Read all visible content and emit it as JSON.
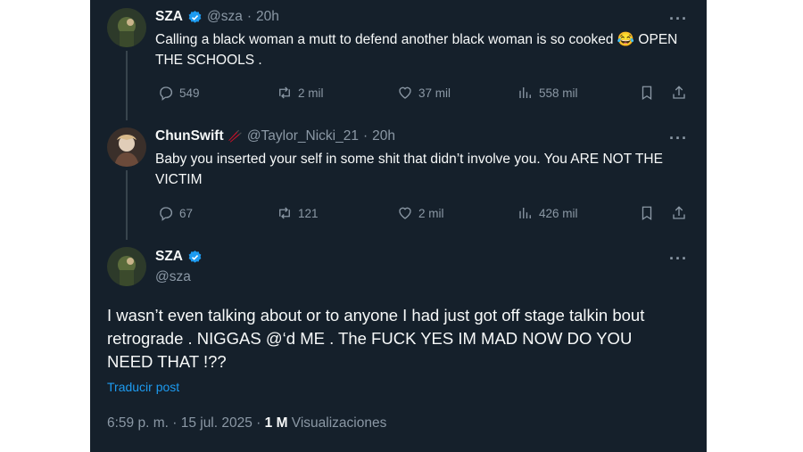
{
  "tweets": [
    {
      "name": "SZA",
      "handle": "@sza",
      "separator": "·",
      "time": "20h",
      "text": "Calling a black woman a mutt to defend another black woman is so cooked 😂 OPEN THE SCHOOLS .",
      "stats": {
        "replies": "549",
        "reposts": "2 mil",
        "likes": "37 mil",
        "views": "558 mil"
      }
    },
    {
      "name": "ChunSwift",
      "name_emoji": "🥢",
      "handle": "@Taylor_Nicki_21",
      "separator": "·",
      "time": "20h",
      "text": "Baby you inserted your self in some shit that didn’t involve you. You ARE NOT THE VICTIM",
      "stats": {
        "replies": "67",
        "reposts": "121",
        "likes": "2 mil",
        "views": "426 mil"
      }
    }
  ],
  "main": {
    "name": "SZA",
    "handle": "@sza",
    "text": "I wasn’t even talking about or to anyone I had just got off stage talkin bout retrograde .  NIGGAS @‘d ME . The FUCK YES IM MAD NOW DO YOU NEED THAT !??",
    "translate": "Traducir post",
    "time": "6:59 p. m. · 15 jul. 2025 ·",
    "views_count": "1 M",
    "views_label": "Visualizaciones"
  },
  "more_glyph": "···",
  "colors": {
    "background": "#15202b",
    "text": "#f7f9f9",
    "muted": "#8b98a5",
    "accent": "#1d9bf0"
  },
  "icons": [
    "verified-badge-icon",
    "reply-icon",
    "repost-icon",
    "like-icon",
    "views-icon",
    "bookmark-icon",
    "share-icon",
    "more-icon"
  ]
}
